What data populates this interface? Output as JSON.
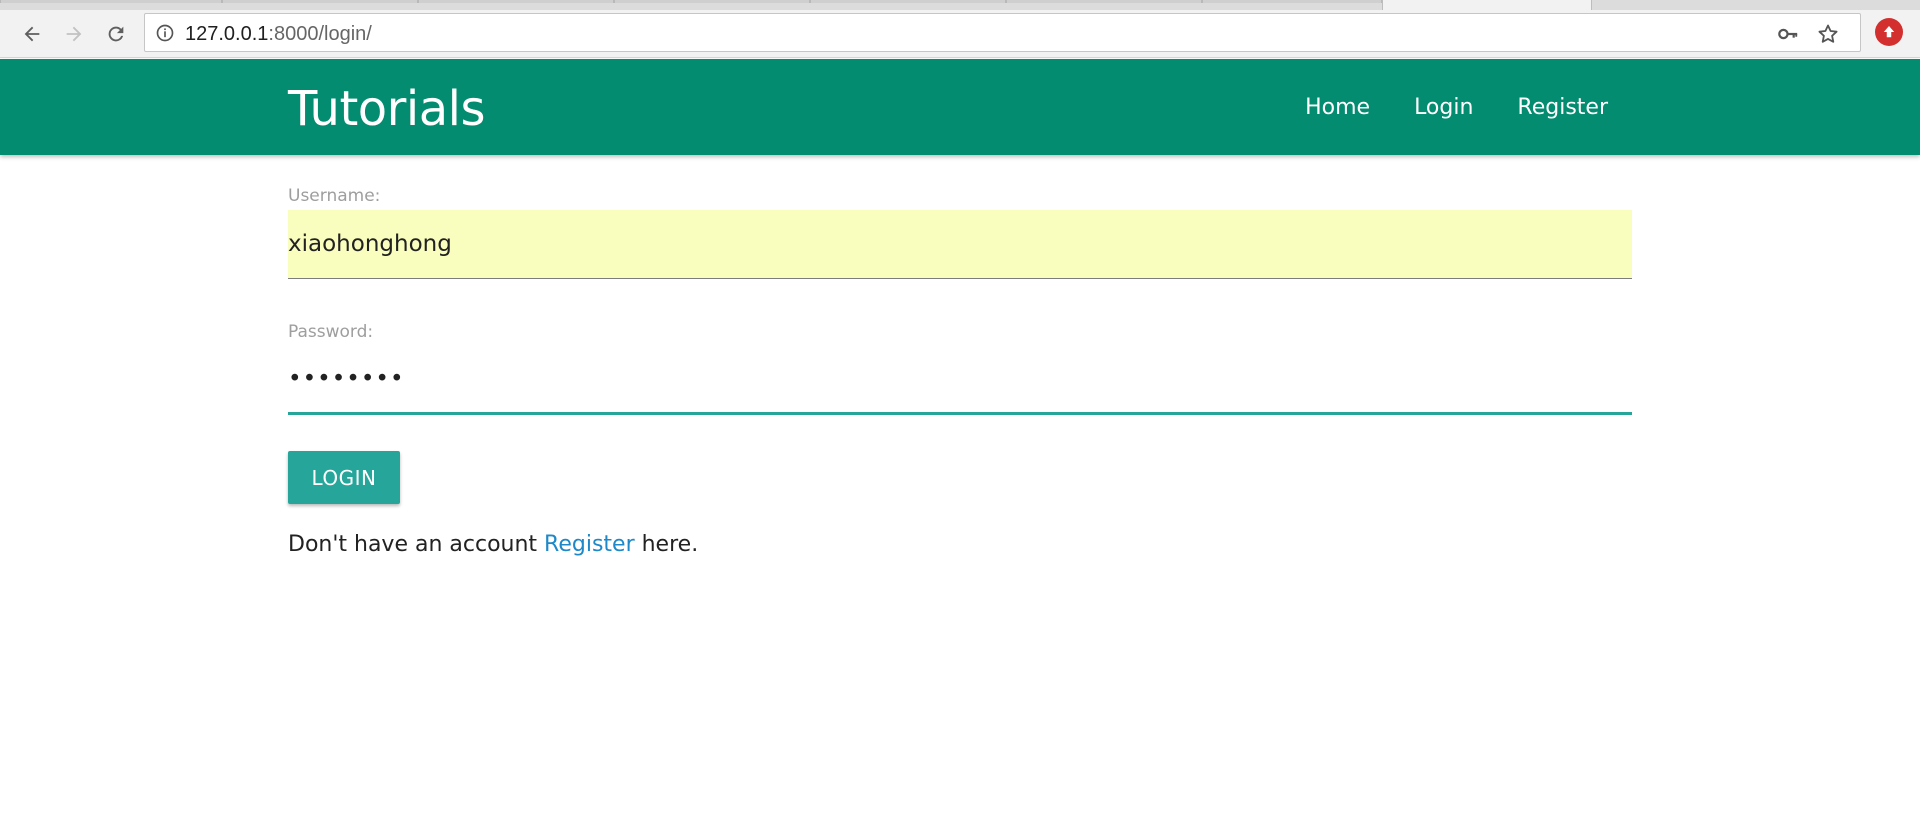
{
  "browser": {
    "url_host": "127.0.0.1",
    "url_rest": ":8000/login/",
    "icons": {
      "back": "arrow-left-icon",
      "forward": "arrow-right-icon",
      "reload": "reload-icon",
      "info": "info-icon",
      "key": "key-icon",
      "bookmark": "star-icon",
      "extension": "upload-arrow-icon"
    }
  },
  "header": {
    "brand": "Tutorials",
    "background": "#038c70",
    "nav": {
      "home": "Home",
      "login": "Login",
      "register": "Register"
    }
  },
  "form": {
    "username_label": "Username:",
    "username_value": "xiaohonghong",
    "password_label": "Password:",
    "password_value": "••••••••",
    "login_button": "LOGIN",
    "accent_color": "#26a69a",
    "autofill_color": "#f9fdbd"
  },
  "footer_text": {
    "prefix": "Don't have an account ",
    "link": "Register",
    "suffix": " here."
  }
}
